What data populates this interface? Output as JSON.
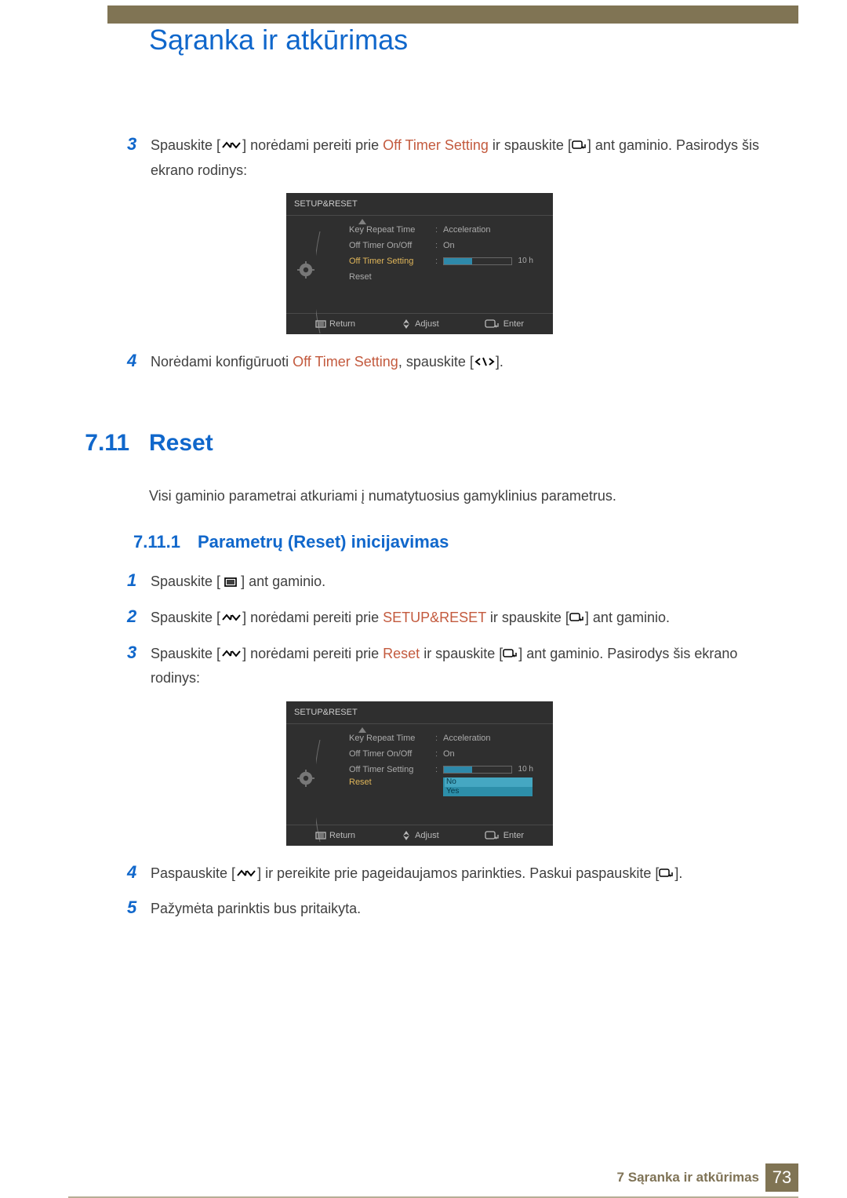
{
  "chapter_title": "Sąranka ir atkūrimas",
  "top_steps": {
    "s3": {
      "num": "3",
      "t1": "Spauskite [",
      "t2": "] norėdami pereiti prie ",
      "highlight": "Off Timer Setting",
      "t3": " ir spauskite [",
      "t4": "] ant gaminio. Pasirodys šis ekrano rodinys:"
    },
    "s4": {
      "num": "4",
      "t1": "Norėdami konfigūruoti ",
      "highlight": "Off Timer Setting",
      "t2": ", spauskite [",
      "t3": "]."
    }
  },
  "section": {
    "num": "7.11",
    "title": "Reset",
    "desc": "Visi gaminio parametrai atkuriami į numatytuosius gamyklinius parametrus."
  },
  "subsection": {
    "num": "7.11.1",
    "title": "Parametrų (Reset) inicijavimas"
  },
  "reset_steps": {
    "s1": {
      "num": "1",
      "t1": "Spauskite [ ",
      "t2": " ] ant gaminio."
    },
    "s2": {
      "num": "2",
      "t1": "Spauskite [",
      "t2": "] norėdami pereiti prie ",
      "highlight": "SETUP&RESET",
      "t3": " ir spauskite [",
      "t4": "] ant gaminio."
    },
    "s3": {
      "num": "3",
      "t1": "Spauskite [",
      "t2": "] norėdami pereiti prie ",
      "highlight": "Reset",
      "t3": " ir spauskite [",
      "t4": "] ant gaminio. Pasirodys šis ekrano rodinys:"
    },
    "s4": {
      "num": "4",
      "t1": "Paspauskite [",
      "t2": "] ir pereikite prie pageidaujamos parinkties. Paskui paspauskite [",
      "t3": "]."
    },
    "s5": {
      "num": "5",
      "t1": "Pažymėta parinktis bus pritaikyta."
    }
  },
  "osd1": {
    "title": "SETUP&RESET",
    "rows": {
      "key": {
        "label": "Key Repeat Time",
        "val": "Acceleration"
      },
      "onoff": {
        "label": "Off Timer On/Off",
        "val": "On"
      },
      "setting": {
        "label": "Off Timer Setting",
        "val": "10 h"
      },
      "reset": {
        "label": "Reset"
      }
    },
    "slider_pct": 42,
    "footer": {
      "return": "Return",
      "adjust": "Adjust",
      "enter": "Enter"
    }
  },
  "osd2": {
    "title": "SETUP&RESET",
    "rows": {
      "key": {
        "label": "Key Repeat Time",
        "val": "Acceleration"
      },
      "onoff": {
        "label": "Off Timer On/Off",
        "val": "On"
      },
      "setting": {
        "label": "Off Timer Setting",
        "val": "10 h"
      },
      "reset": {
        "label": "Reset"
      }
    },
    "slider_pct": 42,
    "dropdown": {
      "no": "No",
      "yes": "Yes"
    },
    "footer": {
      "return": "Return",
      "adjust": "Adjust",
      "enter": "Enter"
    }
  },
  "footer": {
    "text": "7 Sąranka ir atkūrimas",
    "page": "73"
  }
}
